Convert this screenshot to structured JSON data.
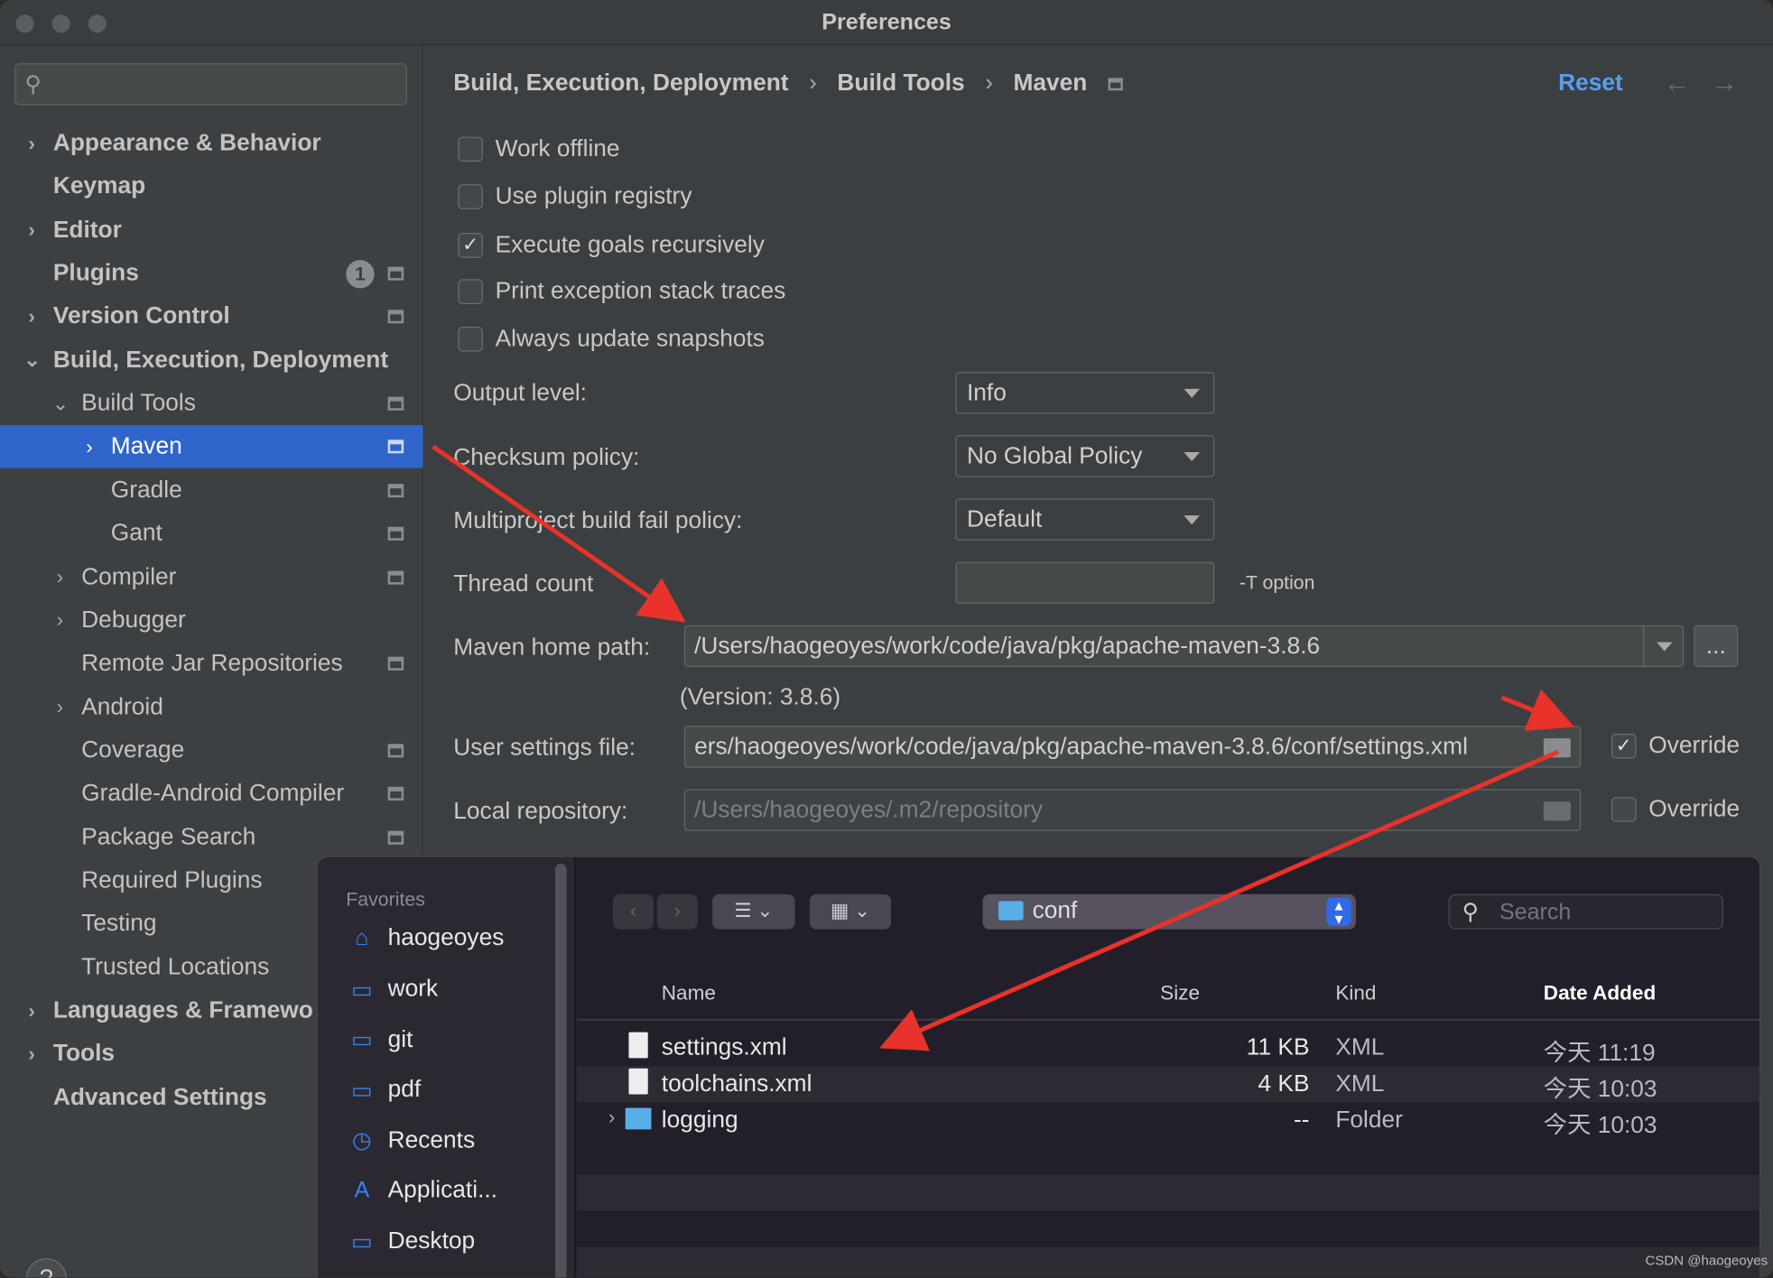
{
  "window": {
    "title": "Preferences"
  },
  "sidebar": {
    "search_placeholder": "",
    "items": [
      {
        "label": "Appearance & Behavior",
        "level": 0,
        "bold": true,
        "chevron": "right"
      },
      {
        "label": "Keymap",
        "level": 0,
        "bold": true
      },
      {
        "label": "Editor",
        "level": 0,
        "bold": true,
        "chevron": "right"
      },
      {
        "label": "Plugins",
        "level": 0,
        "bold": true,
        "badge": "1",
        "project": true
      },
      {
        "label": "Version Control",
        "level": 0,
        "bold": true,
        "chevron": "right",
        "project": true
      },
      {
        "label": "Build, Execution, Deployment",
        "level": 0,
        "bold": true,
        "chevron": "down"
      },
      {
        "label": "Build Tools",
        "level": 1,
        "chevron": "down",
        "project": true
      },
      {
        "label": "Maven",
        "level": 2,
        "chevron": "right",
        "project": true,
        "selected": true
      },
      {
        "label": "Gradle",
        "level": 2,
        "project": true
      },
      {
        "label": "Gant",
        "level": 2,
        "project": true
      },
      {
        "label": "Compiler",
        "level": 1,
        "chevron": "right",
        "project": true
      },
      {
        "label": "Debugger",
        "level": 1,
        "chevron": "right"
      },
      {
        "label": "Remote Jar Repositories",
        "level": 1,
        "project": true
      },
      {
        "label": "Android",
        "level": 1,
        "chevron": "right"
      },
      {
        "label": "Coverage",
        "level": 1,
        "project": true
      },
      {
        "label": "Gradle-Android Compiler",
        "level": 1,
        "project": true
      },
      {
        "label": "Package Search",
        "level": 1,
        "project": true
      },
      {
        "label": "Required Plugins",
        "level": 1
      },
      {
        "label": "Testing",
        "level": 1
      },
      {
        "label": "Trusted Locations",
        "level": 1
      },
      {
        "label": "Languages & Framewo",
        "level": 0,
        "bold": true,
        "chevron": "right"
      },
      {
        "label": "Tools",
        "level": 0,
        "bold": true,
        "chevron": "right"
      },
      {
        "label": "Advanced Settings",
        "level": 0,
        "bold": true
      }
    ],
    "help_label": "?"
  },
  "breadcrumb": [
    "Build, Execution, Deployment",
    "Build Tools",
    "Maven"
  ],
  "breadcrumb_sep": "›",
  "reset_label": "Reset",
  "nav": {
    "back": "←",
    "forward": "→"
  },
  "checkboxes": [
    {
      "label": "Work offline",
      "checked": false
    },
    {
      "label": "Use plugin registry",
      "checked": false
    },
    {
      "label": "Execute goals recursively",
      "checked": true
    },
    {
      "label": "Print exception stack traces",
      "checked": false
    },
    {
      "label": "Always update snapshots",
      "checked": false
    }
  ],
  "form": {
    "output_level": {
      "label": "Output level:",
      "value": "Info"
    },
    "checksum_policy": {
      "label": "Checksum policy:",
      "value": "No Global Policy"
    },
    "fail_policy": {
      "label": "Multiproject build fail policy:",
      "value": "Default"
    },
    "thread_count": {
      "label": "Thread count",
      "value": "",
      "hint": "-T option"
    },
    "maven_home": {
      "label": "Maven home path:",
      "value": "/Users/haogeoyes/work/code/java/pkg/apache-maven-3.8.6",
      "browse": "...",
      "version": "(Version: 3.8.6)"
    },
    "user_settings": {
      "label": "User settings file:",
      "value": "ers/haogeoyes/work/code/java/pkg/apache-maven-3.8.6/conf/settings.xml",
      "override_label": "Override",
      "override": true
    },
    "local_repo": {
      "label": "Local repository:",
      "value": "/Users/haogeoyes/.m2/repository",
      "override_label": "Override",
      "override": false
    }
  },
  "dialog": {
    "favorites_title": "Favorites",
    "favorites": [
      {
        "label": "haogeoyes",
        "icon": "home-icon"
      },
      {
        "label": "work",
        "icon": "folder-icon"
      },
      {
        "label": "git",
        "icon": "folder-icon"
      },
      {
        "label": "pdf",
        "icon": "folder-icon"
      },
      {
        "label": "Recents",
        "icon": "clock-icon"
      },
      {
        "label": "Applicati...",
        "icon": "applications-icon"
      },
      {
        "label": "Desktop",
        "icon": "desktop-icon"
      }
    ],
    "location": "conf",
    "search_placeholder": "Search",
    "columns": [
      "Name",
      "Size",
      "Kind",
      "Date Added"
    ],
    "files": [
      {
        "name": "settings.xml",
        "size": "11 KB",
        "kind": "XML",
        "date": "今天 11:19",
        "type": "file"
      },
      {
        "name": "toolchains.xml",
        "size": "4 KB",
        "kind": "XML",
        "date": "今天 10:03",
        "type": "file"
      },
      {
        "name": "logging",
        "size": "--",
        "kind": "Folder",
        "date": "今天 10:03",
        "type": "folder"
      }
    ]
  },
  "watermark": "CSDN @haogeoyes",
  "colors": {
    "accent": "#2f65ca",
    "link": "#589df6",
    "annotation_arrow": "#e8322a"
  }
}
